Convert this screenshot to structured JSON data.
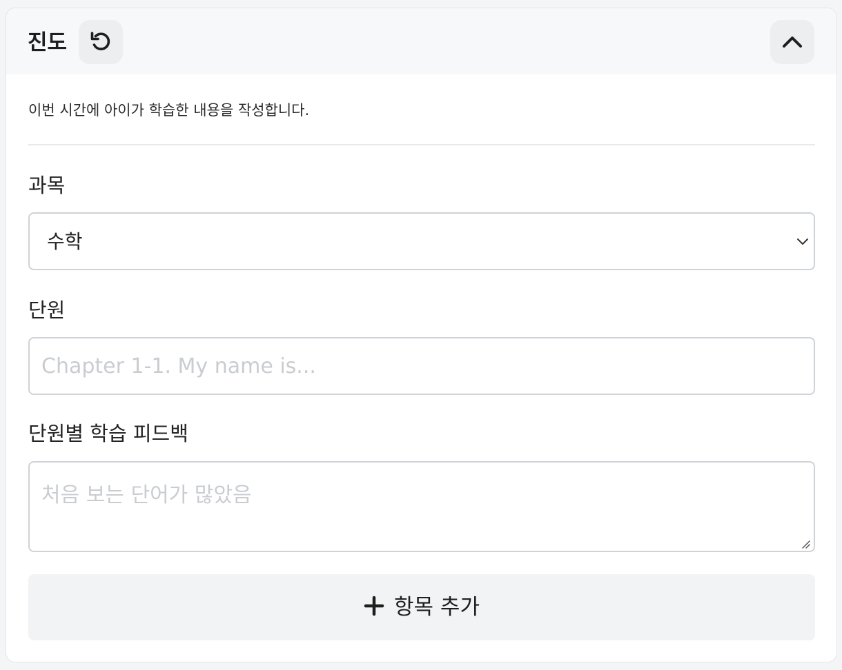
{
  "section": {
    "title": "진도",
    "reset_icon": "reset-icon",
    "collapse_icon": "chevron-up-icon",
    "description": "이번 시간에 아이가 학습한 내용을 작성합니다."
  },
  "form": {
    "subject": {
      "label": "과목",
      "value": "수학",
      "icon": "chevron-down-icon"
    },
    "unit": {
      "label": "단원",
      "placeholder": "Chapter 1-1. My name is...",
      "value": ""
    },
    "feedback": {
      "label": "단원별 학습 피드백",
      "placeholder": "처음 보는 단어가 많았음",
      "value": ""
    }
  },
  "actions": {
    "add_item_label": "항목 추가",
    "add_icon": "plus-icon"
  },
  "colors": {
    "header_bg": "#f7f8f9",
    "input_border": "#cfd2d6",
    "placeholder": "#c9ccd0",
    "button_bg": "#f2f3f5"
  }
}
